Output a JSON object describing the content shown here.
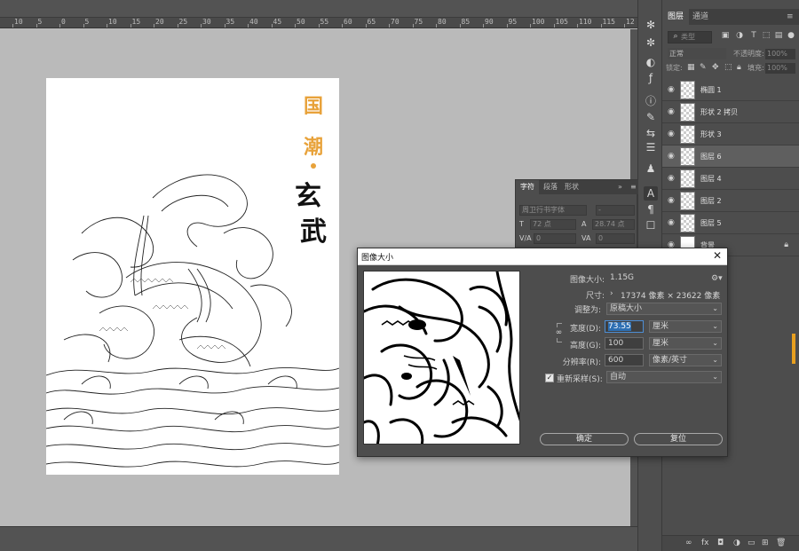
{
  "ruler": {
    "labels": [
      "10",
      "5",
      "0",
      "5",
      "10",
      "15",
      "20",
      "25",
      "30",
      "35",
      "40",
      "45",
      "50",
      "55",
      "60",
      "65",
      "70",
      "75",
      "80",
      "85",
      "90",
      "95",
      "100",
      "105",
      "110",
      "115",
      "12"
    ]
  },
  "document": {
    "marks": {
      "guo": "国",
      "chao": "潮",
      "xuan": "玄",
      "wu": "武"
    }
  },
  "layers_panel": {
    "tabs": [
      "图层",
      "通道"
    ],
    "filter_placeholder": "类型",
    "blend_mode": "正常",
    "opacity_label": "不透明度:",
    "opacity_value": "100%",
    "lock_label": "锁定:",
    "fill_label": "填充:",
    "fill_value": "100%",
    "layers": [
      {
        "name": "椭圆 1",
        "selected": false,
        "locked": false
      },
      {
        "name": "形状 2 拷贝",
        "selected": false,
        "locked": false
      },
      {
        "name": "形状 3",
        "selected": false,
        "locked": false
      },
      {
        "name": "图层 6",
        "selected": true,
        "locked": false
      },
      {
        "name": "图层 4",
        "selected": false,
        "locked": false
      },
      {
        "name": "图层 2",
        "selected": false,
        "locked": false
      },
      {
        "name": "图层 5",
        "selected": false,
        "locked": false
      },
      {
        "name": "背景",
        "selected": false,
        "locked": true
      }
    ]
  },
  "character_panel": {
    "tabs": [
      "字符",
      "段落",
      "形状"
    ],
    "font_family": "周卫行书字体",
    "font_style": "-",
    "font_size": "72 点",
    "leading": "28.74 点",
    "kerning": "0",
    "tracking": "0"
  },
  "dialog": {
    "title": "图像大小",
    "image_size_label": "图像大小:",
    "image_size_value": "1.15G",
    "dimensions_label": "尺寸:",
    "dimensions_value": "17374 像素 × 23622 像素",
    "fit_to_label": "调整为:",
    "fit_to_value": "原稿大小",
    "width_label": "宽度(D):",
    "width_value": "73.55",
    "width_unit": "厘米",
    "height_label": "高度(G):",
    "height_value": "100",
    "height_unit": "厘米",
    "resolution_label": "分辨率(R):",
    "resolution_value": "600",
    "resolution_unit": "像素/英寸",
    "resample_label": "重新采样(S):",
    "resample_checked": true,
    "resample_value": "自动",
    "ok_label": "确定",
    "reset_label": "复位"
  }
}
